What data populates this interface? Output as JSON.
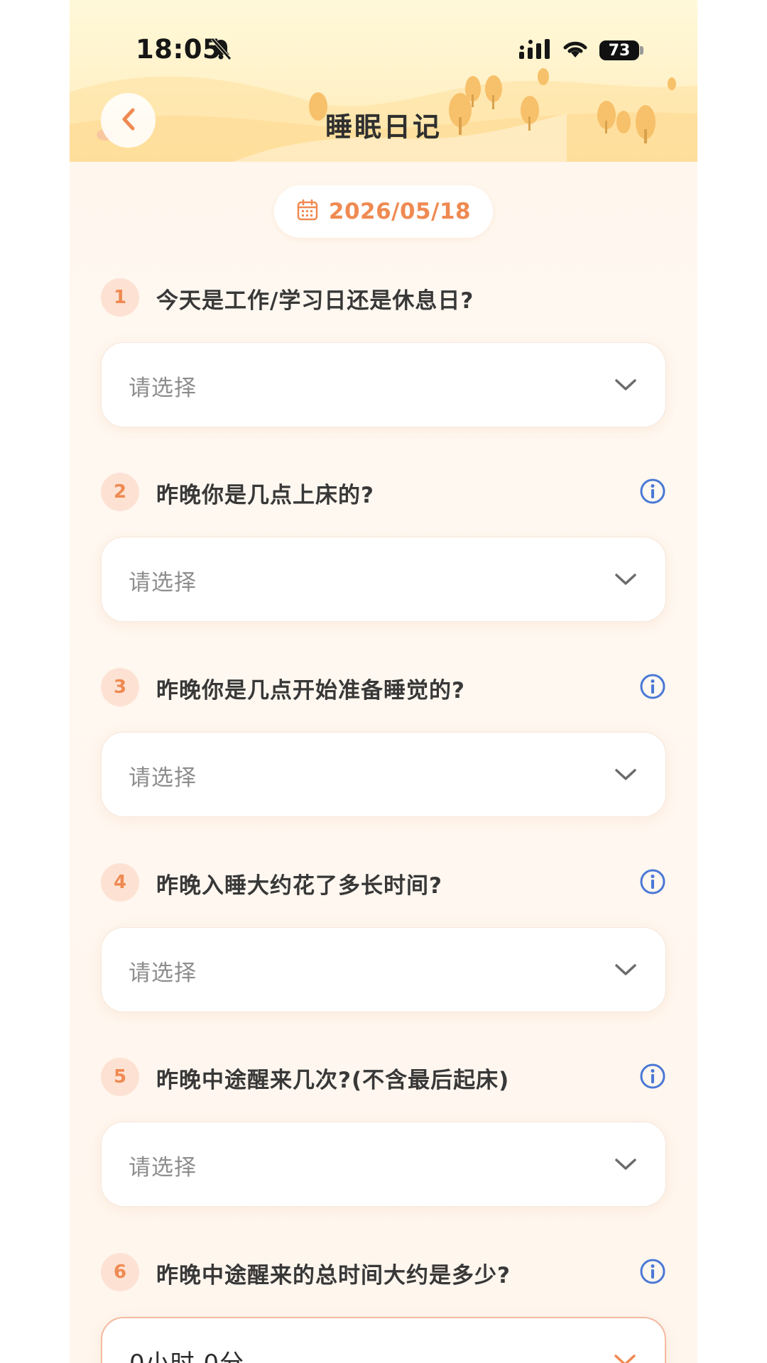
{
  "status_bar": {
    "time": "18:05",
    "battery": "73"
  },
  "header": {
    "title": "睡眠日记"
  },
  "date": {
    "value": "2026/05/18"
  },
  "questions": [
    {
      "num": "1",
      "text": "今天是工作/学习日还是休息日?",
      "has_info": false,
      "value": "请选择"
    },
    {
      "num": "2",
      "text": "昨晚你是几点上床的?",
      "has_info": true,
      "value": "请选择"
    },
    {
      "num": "3",
      "text": "昨晚你是几点开始准备睡觉的?",
      "has_info": true,
      "value": "请选择"
    },
    {
      "num": "4",
      "text": "昨晚入睡大约花了多长时间?",
      "has_info": true,
      "value": "请选择"
    },
    {
      "num": "5",
      "text": "昨晚中途醒来几次?(不含最后起床)",
      "has_info": true,
      "value": "请选择"
    },
    {
      "num": "6",
      "text": "昨晚中途醒来的总时间大约是多少?",
      "has_info": true,
      "value": "0小时 0分"
    }
  ],
  "colors": {
    "accent": "#ef8a52",
    "info": "#4a78d6",
    "background": "#fff7ef"
  },
  "icons": [
    "bell-slash-icon",
    "signal-icon",
    "wifi-icon",
    "back-chevron-icon",
    "calendar-icon",
    "info-icon",
    "chevron-down-icon"
  ]
}
